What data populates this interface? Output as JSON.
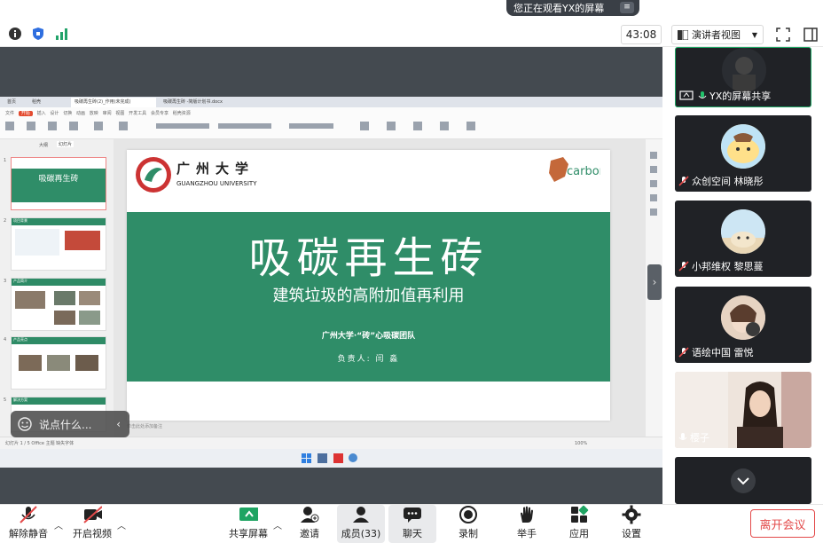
{
  "banner": {
    "text": "您正在观看YX的屏幕",
    "menu_icon": "hamburger-icon"
  },
  "topbar": {
    "timer": "43:08",
    "view_mode": "演讲者视图"
  },
  "shared_doc": {
    "tabs": [
      "首页",
      "稻壳",
      "吸碳再生砖(2)_作用(未完成)",
      "吸碳再生砖 -简版计划书.docx"
    ],
    "ribbon_tabs": [
      "文件",
      "开始",
      "插入",
      "设计",
      "切换",
      "动画",
      "放映",
      "审阅",
      "视图",
      "开发工具",
      "会员专享",
      "稻壳资源"
    ],
    "panel_tabs": [
      "大纲",
      "幻灯片"
    ],
    "thumbnails": [
      {
        "num": "1",
        "title": "吸碳再生砖"
      },
      {
        "num": "2",
        "title": "项目背景"
      },
      {
        "num": "3",
        "title": "产品简介"
      },
      {
        "num": "4",
        "title": "产品亮点"
      },
      {
        "num": "5",
        "title": "解决方案"
      }
    ],
    "slide": {
      "university_cn": "广州大学",
      "university_en": "GUANGZHOU UNIVERSITY",
      "brand": "carbon",
      "title": "吸碳再生砖",
      "subtitle": "建筑垃圾的高附加值再利用",
      "team": "广州大学·“砖”心吸碳团队",
      "leader": "负责人:     闫  淼"
    },
    "statusbar": "幻灯片 1 / 5    Office 主题    缺失字体",
    "notes_hint": "单击此处添加备注",
    "zoom": "100%"
  },
  "chat_input": {
    "placeholder": "说点什么..."
  },
  "participants": [
    {
      "name": "YX的屏幕共享",
      "avatar": "person-icon",
      "muted": false
    },
    {
      "name": "众创空间 林晓彤",
      "avatar": "pudding-icon",
      "muted": true
    },
    {
      "name": "小邦维权 黎思蔓",
      "avatar": "dog-icon",
      "muted": true
    },
    {
      "name": "语绘中国 雷悦",
      "avatar": "photo-icon",
      "muted": true
    },
    {
      "name": "樱子",
      "avatar": "video-icon",
      "muted": false
    }
  ],
  "bottombar": {
    "mute": "解除静音",
    "video": "开启视频",
    "share": "共享屏幕",
    "invite": "邀请",
    "members": "成员(33)",
    "chat": "聊天",
    "record": "录制",
    "raise": "举手",
    "apps": "应用",
    "settings": "设置",
    "leave": "离开会议"
  },
  "colors": {
    "slide_green": "#2f8d68",
    "leave_red": "#e34a4a",
    "active_green": "#1fa463"
  }
}
